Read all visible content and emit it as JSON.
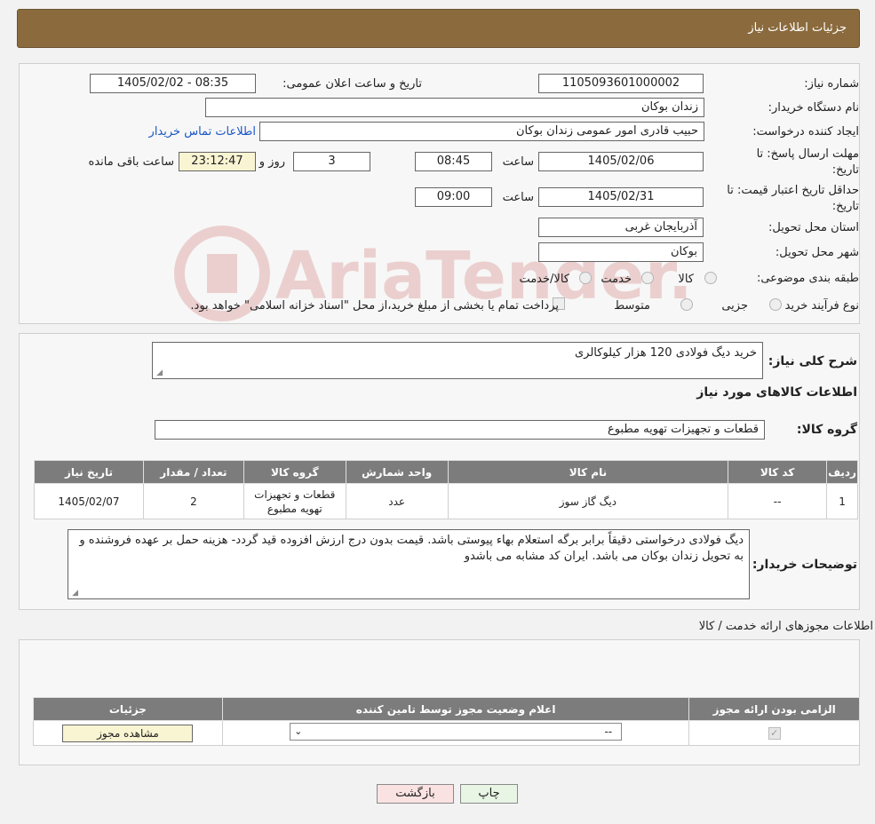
{
  "header": {
    "title": "جزئیات اطلاعات نیاز"
  },
  "info": {
    "need_number_label": "شماره نیاز:",
    "need_number": "1105093601000002",
    "announce_label": "تاریخ و ساعت اعلان عمومی:",
    "announce_value": "1405/02/02 - 08:35",
    "buyer_org_label": "نام دستگاه خریدار:",
    "buyer_org": "زندان بوکان",
    "creator_label": "ایجاد کننده درخواست:",
    "creator": "حبیب قادری امور عمومی  زندان بوکان",
    "contact_link": "اطلاعات تماس خریدار",
    "deadline_label_1": "مهلت ارسال پاسخ: تا",
    "deadline_label_2": "تاریخ:",
    "deadline_date": "1405/02/06",
    "time_label": "ساعت",
    "deadline_time": "08:45",
    "days": "3",
    "days_label": "روز و",
    "remaining": "23:12:47",
    "remaining_label": "ساعت باقی مانده",
    "price_valid_label_1": "حداقل تاریخ اعتبار قیمت: تا",
    "price_valid_label_2": "تاریخ:",
    "price_valid_date": "1405/02/31",
    "price_valid_time": "09:00",
    "province_label": "استان محل تحویل:",
    "province": "آذربایجان غربی",
    "city_label": "شهر محل تحویل:",
    "city": "بوکان",
    "category_label": "طبقه بندی موضوعی:",
    "category_options": [
      "کالا",
      "خدمت",
      "کالا/خدمت"
    ],
    "process_label": "نوع فرآیند خرید :",
    "process_options": [
      "جزیی",
      "متوسط"
    ],
    "process_note": "پرداخت تمام یا بخشی از مبلغ خرید،از محل \"اسناد خزانه اسلامی\" خواهد بود."
  },
  "goods": {
    "summary_label": "شرح کلی نیاز:",
    "summary": "خرید دیگ فولادی 120 هزار کیلوکالری",
    "section_title": "اطلاعات کالاهای مورد نیاز",
    "group_label": "گروه کالا:",
    "group": "قطعات و تجهیزات تهویه مطبوع",
    "table": {
      "headers": [
        "ردیف",
        "کد کالا",
        "نام کالا",
        "واحد شمارش",
        "گروه کالا",
        "تعداد / مقدار",
        "تاریخ نیاز"
      ],
      "rows": [
        [
          "1",
          "--",
          "دیگ گاز سوز",
          "عدد",
          "قطعات و تجهیزات تهویه مطبوع",
          "2",
          "1405/02/07"
        ]
      ]
    },
    "buyer_notes_label": "توضیحات خریدار:",
    "buyer_notes": "دیگ فولادی درخواستی دقیقاً برابر برگه استعلام بهاء پیوستی باشد. قیمت بدون درج ارزش افزوده قید گردد- هزینه حمل بر عهده فروشنده  و به تحویل زندان بوکان می باشد. ایران کد مشابه می باشدو"
  },
  "permits": {
    "section_title": "اطلاعات مجوزهای ارائه خدمت / کالا",
    "headers": [
      "الزامی بودن ارائه مجوز",
      "اعلام وضعیت مجوز توسط تامین کننده",
      "جزئیات"
    ],
    "status_select": "--",
    "view_button": "مشاهده مجوز"
  },
  "footer": {
    "print_button": "چاپ",
    "back_button": "بازگشت"
  },
  "watermark": {
    "text": "AriaTender.neT"
  },
  "colors": {
    "header_bg": "#8b6b3d",
    "table_header": "#7c7c7c",
    "link": "#1a55c7"
  }
}
